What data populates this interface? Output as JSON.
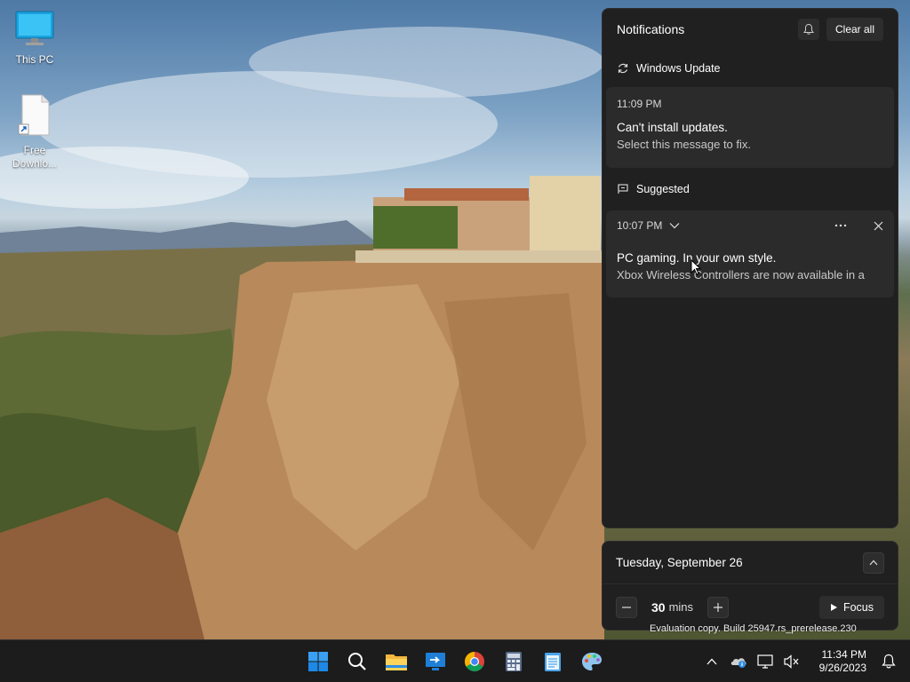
{
  "desktop": {
    "icons": [
      {
        "label": "This PC",
        "icon": "monitor-icon"
      },
      {
        "label": "Free Downlo...",
        "icon": "file-shortcut-icon"
      }
    ]
  },
  "notifications": {
    "title": "Notifications",
    "clear_all": "Clear all",
    "groups": [
      {
        "app": "Windows Update",
        "icon": "refresh-icon"
      },
      {
        "app": "Suggested",
        "icon": "suggested-app-icon"
      }
    ],
    "cards": [
      {
        "time": "11:09 PM",
        "title": "Can't install updates.",
        "body": "Select this message to fix."
      },
      {
        "time": "10:07 PM",
        "title": "PC gaming. In your own style.",
        "body": "Xbox Wireless Controllers are now available in a"
      }
    ]
  },
  "calendar": {
    "date": "Tuesday, September 26",
    "focus_minutes": "30",
    "focus_unit": "mins",
    "focus_label": "Focus"
  },
  "watermark": "Evaluation copy. Build 25947.rs_prerelease.230",
  "taskbar": {
    "apps": [
      "windows-start-icon",
      "search-icon",
      "file-explorer-icon",
      "remote-desktop-icon",
      "chrome-icon",
      "calculator-icon",
      "notepad-icon",
      "paint-icon"
    ],
    "clock_time": "11:34 PM",
    "clock_date": "9/26/2023"
  },
  "colors": {
    "panel_bg": "#202020",
    "card_bg": "#2b2b2b",
    "taskbar_bg": "#1c1c1c",
    "accent": "#0078d4"
  }
}
